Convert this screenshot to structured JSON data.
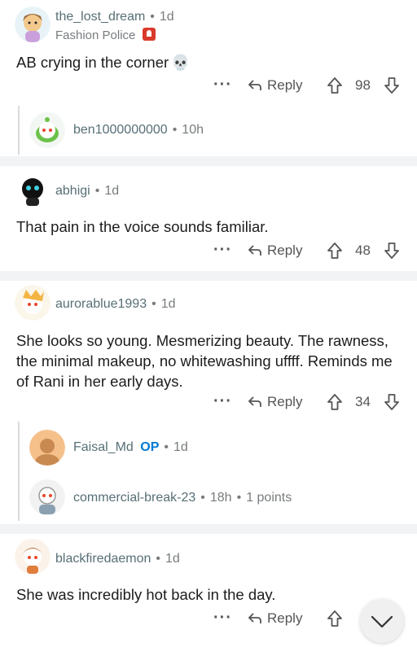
{
  "comments": [
    {
      "username": "the_lost_dream",
      "time": "1d",
      "flair": "Fashion Police",
      "flair_icon": "siren-icon",
      "body": "AB crying in the corner",
      "emoji": "💀",
      "reply_label": "Reply",
      "score": "98",
      "reply": {
        "username": "ben1000000000",
        "time": "10h"
      }
    },
    {
      "username": "abhigi",
      "time": "1d",
      "body": "That pain in the voice sounds familiar.",
      "reply_label": "Reply",
      "score": "48"
    },
    {
      "username": "aurorablue1993",
      "time": "1d",
      "body": "She looks so young. Mesmerizing beauty. The rawness, the minimal makeup, no whitewashing uffff. Reminds me of Rani in her early days.",
      "reply_label": "Reply",
      "score": "34",
      "replies": [
        {
          "username": "Faisal_Md",
          "badge": "OP",
          "time": "1d"
        },
        {
          "username": "commercial-break-23",
          "time": "18h",
          "points": "1 points"
        }
      ]
    },
    {
      "username": "blackfiredaemon",
      "time": "1d",
      "body": "She was incredibly hot back in the day.",
      "reply_label": "Reply"
    }
  ],
  "colors": {
    "separator": "#f2f3f5",
    "op_badge": "#0079d3",
    "flair_icon": "#d93a2b"
  }
}
